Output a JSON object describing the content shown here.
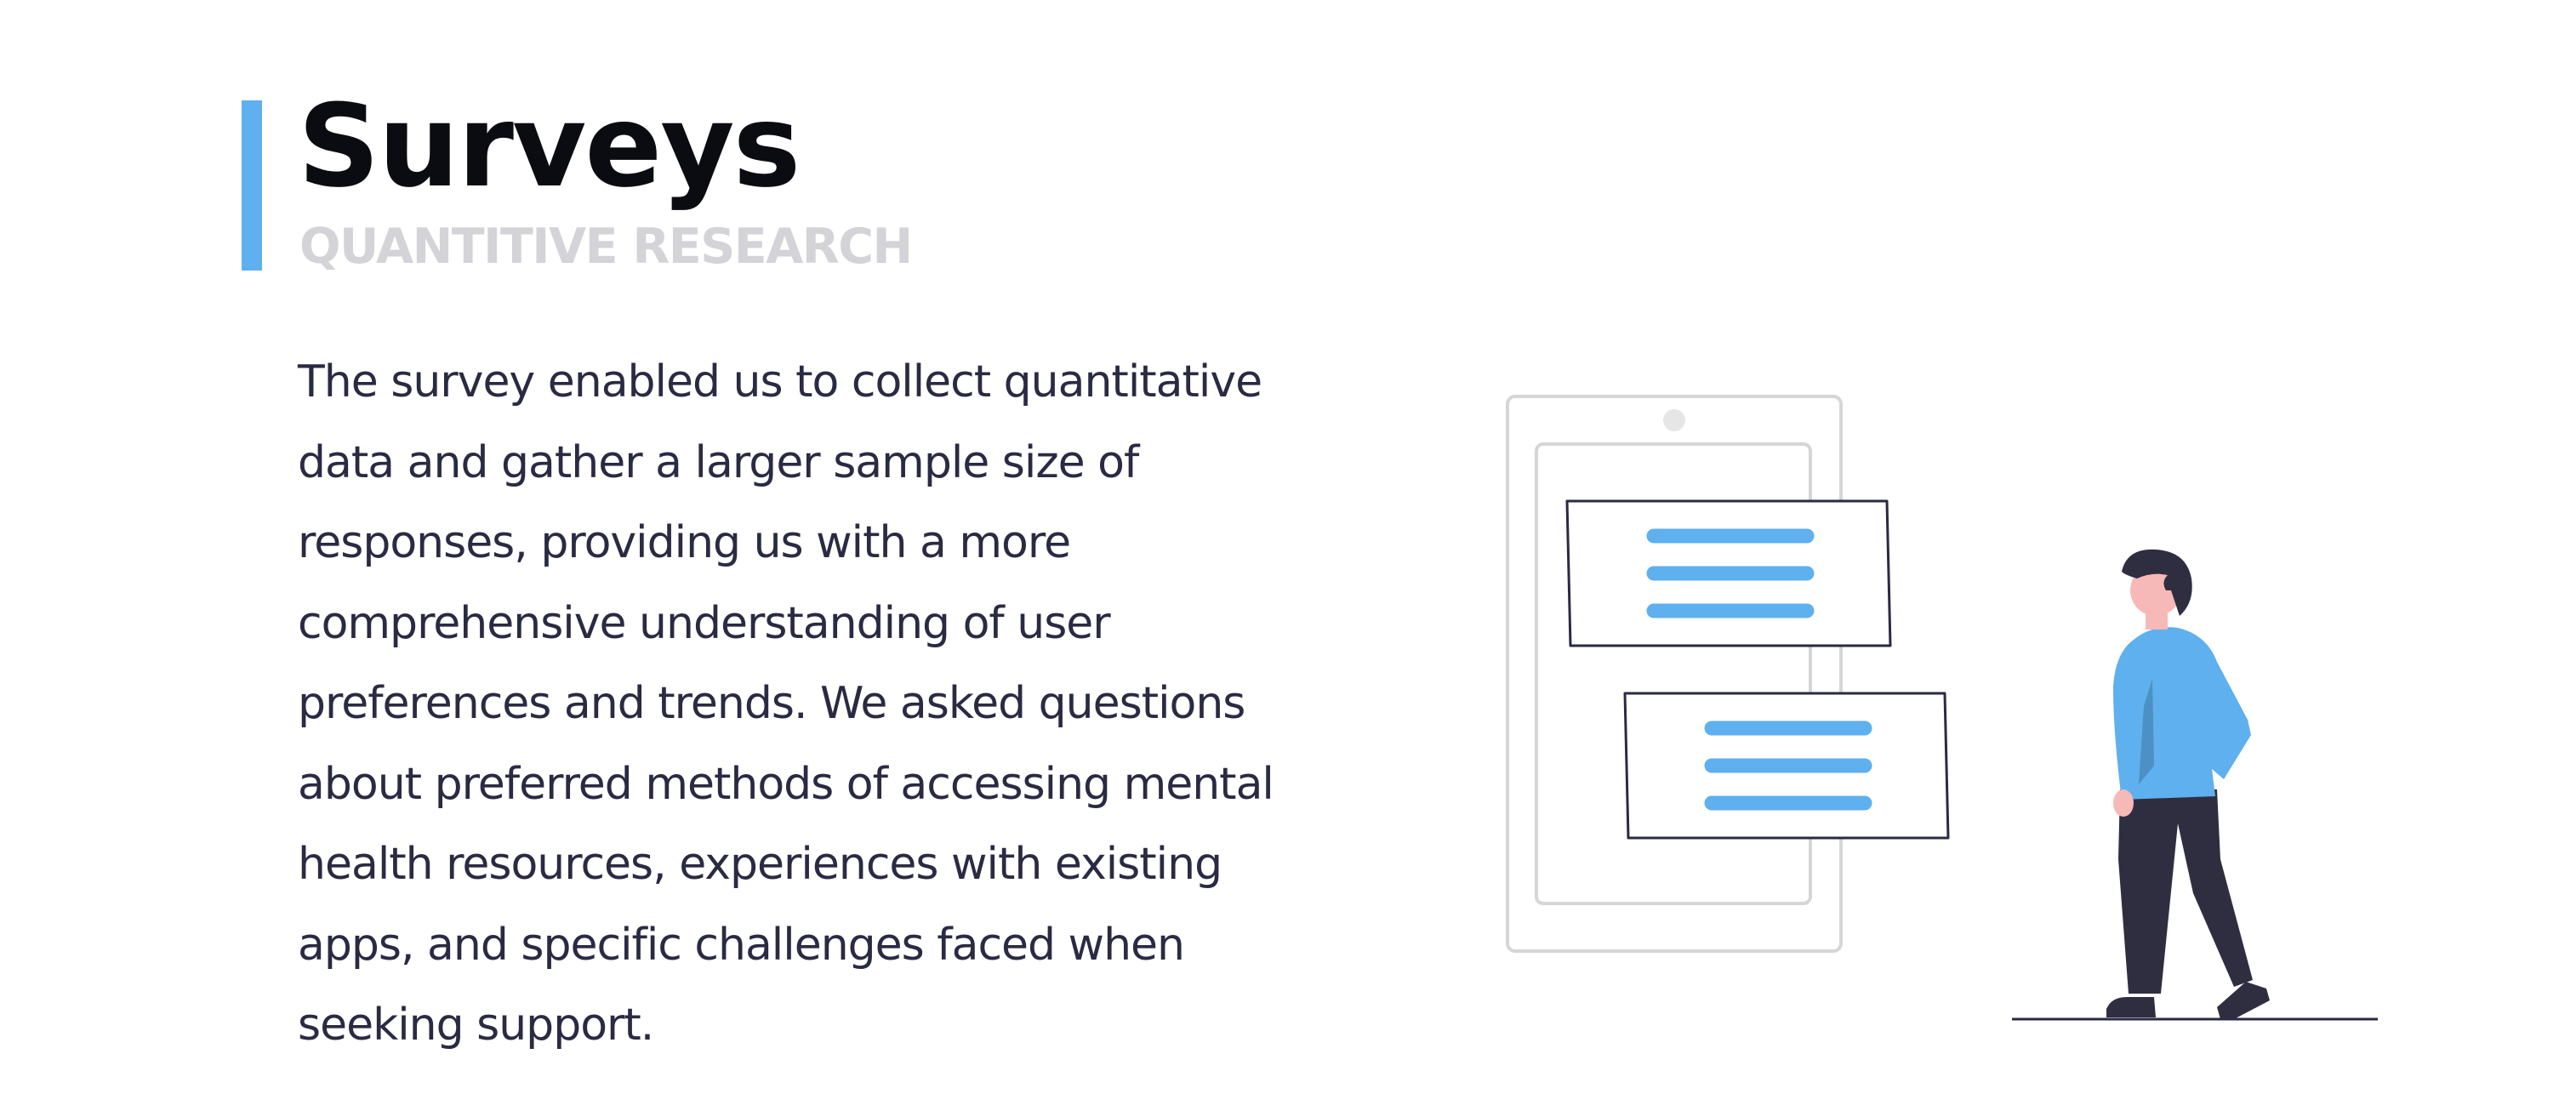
{
  "section": {
    "title": "Surveys",
    "subtitle": "QUANTITIVE RESEARCH"
  },
  "body": {
    "lines": [
      "The survey enabled us to collect quantitative",
      "data and gather a larger sample size of",
      "responses, providing us with a more",
      "comprehensive understanding of user",
      "preferences and trends. We asked questions",
      "about preferred methods of accessing mental",
      "health resources, experiences with existing",
      "apps, and specific challenges faced when",
      "seeking support."
    ]
  },
  "illustration": {
    "icon": "person-viewing-phone-survey-illustration",
    "colors": {
      "accent": "#5eb0ee",
      "outline": "#2a2a43",
      "phone": "#d6d6d6",
      "skin": "#f7b8b8"
    }
  },
  "colors": {
    "accent_bar": "#5eb0ee",
    "title": "#0b0b12",
    "subtitle": "#d3d3d8",
    "body": "#2a2a43"
  }
}
